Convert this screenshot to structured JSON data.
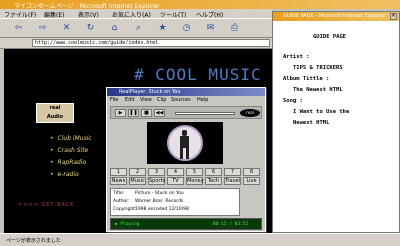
{
  "browser": {
    "title": "マイコンホームページ - Microsoft Internet Explorer",
    "menu": [
      "ファイル(F)",
      "編集(E)",
      "表示(V)",
      "お気に入り(A)",
      "ツール(T)",
      "ヘルプ(H)"
    ],
    "address": "http://www.coolmusic.com/guide/index.html",
    "status": "ページが表示されました"
  },
  "page": {
    "heading": "# COOL MUSIC",
    "logo_top": "real",
    "logo_bottom": "Audio",
    "links": [
      "Club iMusic",
      "Crash Site",
      "RapRadio",
      "e-radio"
    ],
    "back_link": "<<<< GET BACK"
  },
  "player": {
    "title": "RealPlayer: Stuck on You",
    "menu": [
      "File",
      "Edit",
      "View",
      "Clip",
      "Sources",
      "Help"
    ],
    "logo": "real",
    "channels_top": [
      "1",
      "2",
      "3",
      "4",
      "5",
      "6",
      "7",
      "8"
    ],
    "channels_bottom": [
      "News",
      "Music",
      "Sports",
      "TV",
      "Money",
      "Tech",
      "Travel",
      "Live"
    ],
    "info": [
      {
        "label": "Title:",
        "value": "Picture - Stuck on You"
      },
      {
        "label": "Author:",
        "value": "Warner Bros. Records"
      },
      {
        "label": "Copyright:",
        "value": "1998      encoded 12/10/98"
      }
    ],
    "lcd_left": "▶ Playing",
    "lcd_right": "00:15 / 03:52"
  },
  "guide": {
    "window_title": "GUIDE PAGE - Microsoft Internet Explorer",
    "heading": "GUIDE PAGE",
    "artist_label": "Artist :",
    "artist": "TIPS & TRICKERS",
    "album_label": "Album Tittle :",
    "album": "The Newest HTML",
    "song_label": "Song :",
    "song_1": "I Want to Use the",
    "song_2": "Newest HTML"
  }
}
